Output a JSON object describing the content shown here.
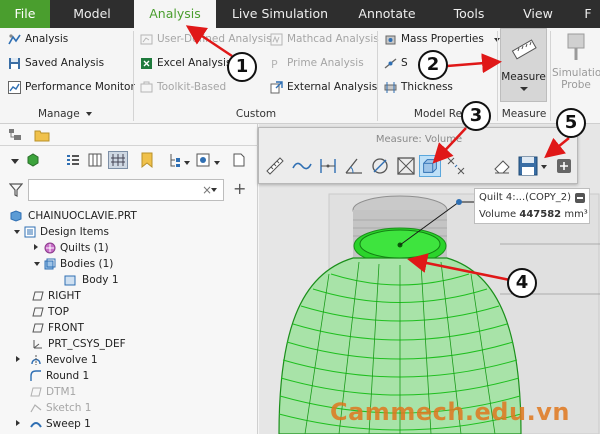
{
  "tabs": [
    "File",
    "Model",
    "Analysis",
    "Live Simulation",
    "Annotate",
    "Tools",
    "View",
    "F"
  ],
  "ribbon": {
    "manage": {
      "items": [
        "Analysis",
        "Saved Analysis",
        "Performance Monitor"
      ],
      "group_label": "Manage"
    },
    "custom": {
      "items_col1": [
        "User-Defined Analysis",
        "Excel Analysis",
        "Toolkit-Based"
      ],
      "items_col2": [
        "Mathcad Analysis",
        "Prime Analysis",
        "External Analysis"
      ],
      "group_label": "Custom"
    },
    "model_report": {
      "items": [
        "Mass Properties",
        "S",
        "Thickness"
      ],
      "group_label": "Model Re"
    },
    "measure": {
      "button_label": "Measure",
      "group_label": "Measure"
    },
    "simulation": {
      "label_line1": "Simulation",
      "label_line2": "Probe"
    }
  },
  "tree": {
    "items": [
      "CHAINUOCLAVIE.PRT",
      "Design Items",
      "Quilts (1)",
      "Bodies (1)",
      "Body 1",
      "RIGHT",
      "TOP",
      "FRONT",
      "PRT_CSYS_DEF",
      "Revolve 1",
      "Round 1",
      "DTM1",
      "Sketch 1",
      "Sweep 1"
    ]
  },
  "measure_toolbar": {
    "title": "Measure: Volume"
  },
  "result": {
    "name": "Quilt 4:...(COPY_2)",
    "label": "Volume",
    "value": "447582",
    "unit": "mm³"
  },
  "badges": [
    "1",
    "2",
    "3",
    "4",
    "5"
  ],
  "watermark": "Cammech.edu.vn",
  "colors": {
    "file_tab": "#4a9e2e",
    "active_tab_text": "#4a9e2e",
    "selection_green": "#22c922",
    "annotation_red": "#e01818",
    "watermark": "#e0781e"
  }
}
